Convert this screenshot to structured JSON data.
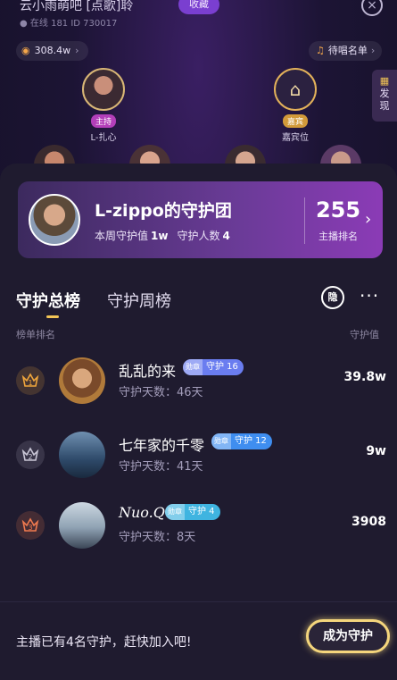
{
  "room": {
    "title": "云小雨萌吧    [点歌]聆",
    "meta": "● 在线 181   ID 730017",
    "favorite_label": "收藏",
    "heat": "308.4w",
    "song_list": "待唱名单",
    "discover_label": "发现"
  },
  "seats": [
    {
      "tag": "主持",
      "name": "L-扎心"
    },
    {
      "tag": "嘉宾",
      "name": "嘉宾位"
    }
  ],
  "banner": {
    "title": "L-zippo的守护团",
    "week_value_label": "本周守护值",
    "week_value": "1w",
    "guard_count_label": "守护人数",
    "guard_count": "4",
    "rank_value": "255",
    "rank_label": "主播排名"
  },
  "tabs": {
    "total": "守护总榜",
    "weekly": "守护周榜",
    "hide_icon_text": "隐"
  },
  "columns": {
    "left": "榜单排名",
    "right": "守护值"
  },
  "rows": [
    {
      "rank": "1",
      "name": "乱乱的来",
      "badge_lv": "勋章",
      "badge": "守护 16",
      "days": "守护天数：46天",
      "value": "39.8w"
    },
    {
      "rank": "2",
      "name": "七年家的千零",
      "badge_lv": "勋章",
      "badge": "守护 12",
      "days": "守护天数：41天",
      "value": "9w"
    },
    {
      "rank": "3",
      "name": "Nuo.Q",
      "badge_lv": "勋章",
      "badge": "守护 4",
      "days": "守护天数：8天",
      "value": "3908"
    }
  ],
  "footer": {
    "text": "主播已有4名守护，赶快加入吧!",
    "button": "成为守护"
  },
  "colors": {
    "accent_gold": "#f4d57c",
    "rank1": "#f0a63c",
    "rank2": "#c9c6d6",
    "rank3": "#f07a4f"
  }
}
